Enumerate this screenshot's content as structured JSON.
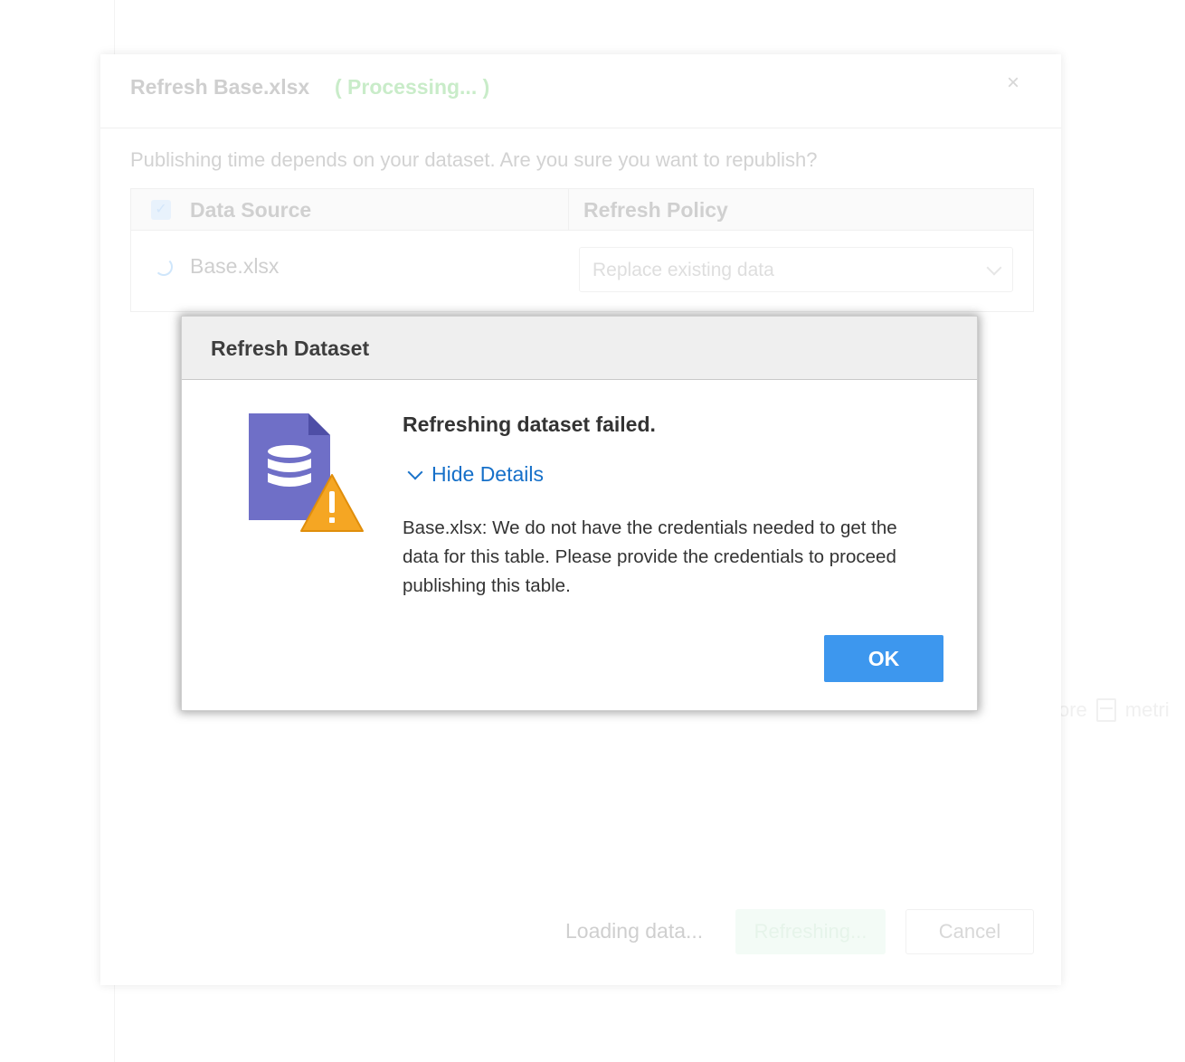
{
  "background": {
    "fragment_text_left": "ore",
    "fragment_text_right": "metri"
  },
  "outer_dialog": {
    "title": "Refresh Base.xlsx",
    "status": "( Processing... )",
    "close_icon": "×",
    "message": "Publishing time depends on your dataset. Are you sure you want to republish?",
    "table": {
      "columns": [
        "Data Source",
        "Refresh Policy"
      ],
      "rows": [
        {
          "data_source": "Base.xlsx",
          "refresh_policy": "Replace existing data"
        }
      ]
    },
    "footer": {
      "status_text": "Loading data...",
      "refresh_button": "Refreshing...",
      "cancel_button": "Cancel"
    }
  },
  "modal": {
    "title": "Refresh Dataset",
    "icon": "database-file-warning-icon",
    "heading": "Refreshing dataset failed.",
    "details_toggle": "Hide Details",
    "detail_text": "Base.xlsx: We do not have the credentials needed to get the data for this table. Please provide the credentials to proceed publishing this table.",
    "ok_button": "OK"
  },
  "colors": {
    "accent": "#3d97ee",
    "link": "#1670c9",
    "processing": "#c9ecc9",
    "file_icon": "#6f6fc7",
    "warning": "#f5a623"
  }
}
